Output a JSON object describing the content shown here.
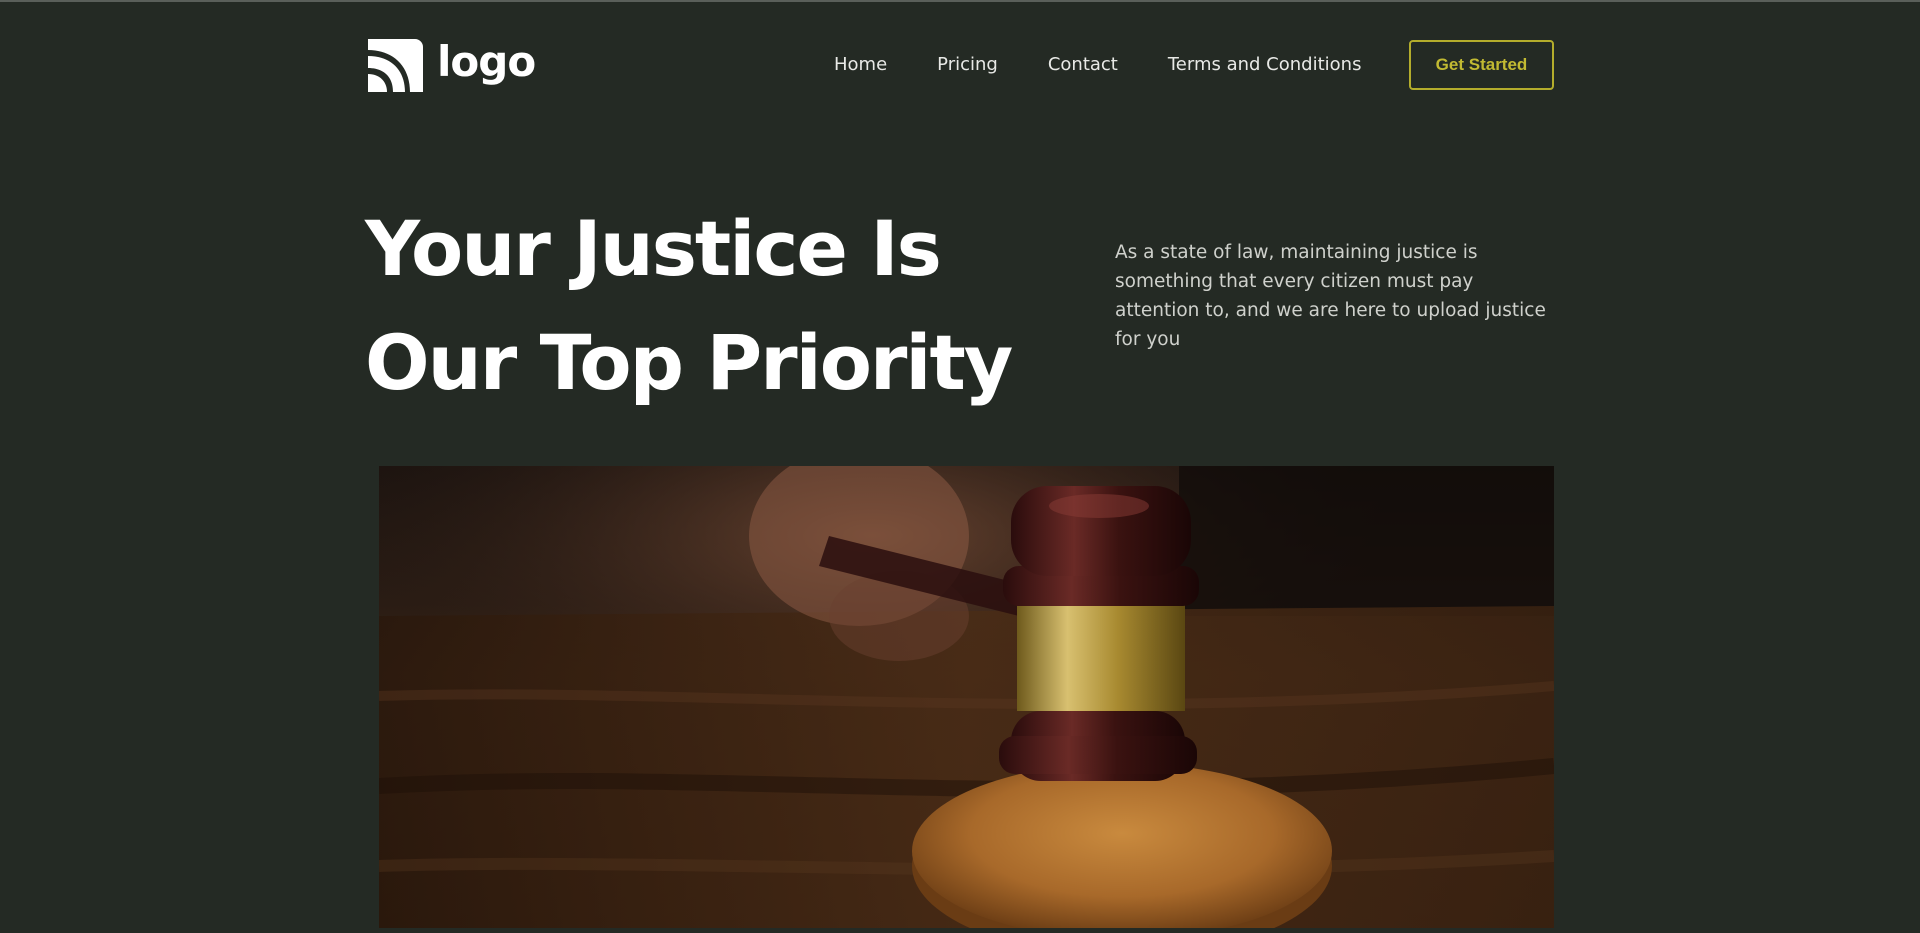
{
  "header": {
    "logo_text": "logo",
    "logo_icon": "signal-arcs-icon",
    "nav": [
      {
        "label": "Home"
      },
      {
        "label": "Pricing"
      },
      {
        "label": "Contact"
      },
      {
        "label": "Terms and Conditions"
      }
    ],
    "cta_label": "Get Started"
  },
  "hero": {
    "title_line1": "Your Justice Is",
    "title_line2": "Our Top Priority",
    "description": "As a state of law, maintaining justice is something that every citizen must pay attention to, and we are here to upload justice for you",
    "image_subject": "gavel-on-sound-block"
  },
  "colors": {
    "background": "#242a24",
    "accent": "#b4ad2c",
    "text_primary": "#ffffff",
    "text_secondary": "#cfd1cc"
  }
}
